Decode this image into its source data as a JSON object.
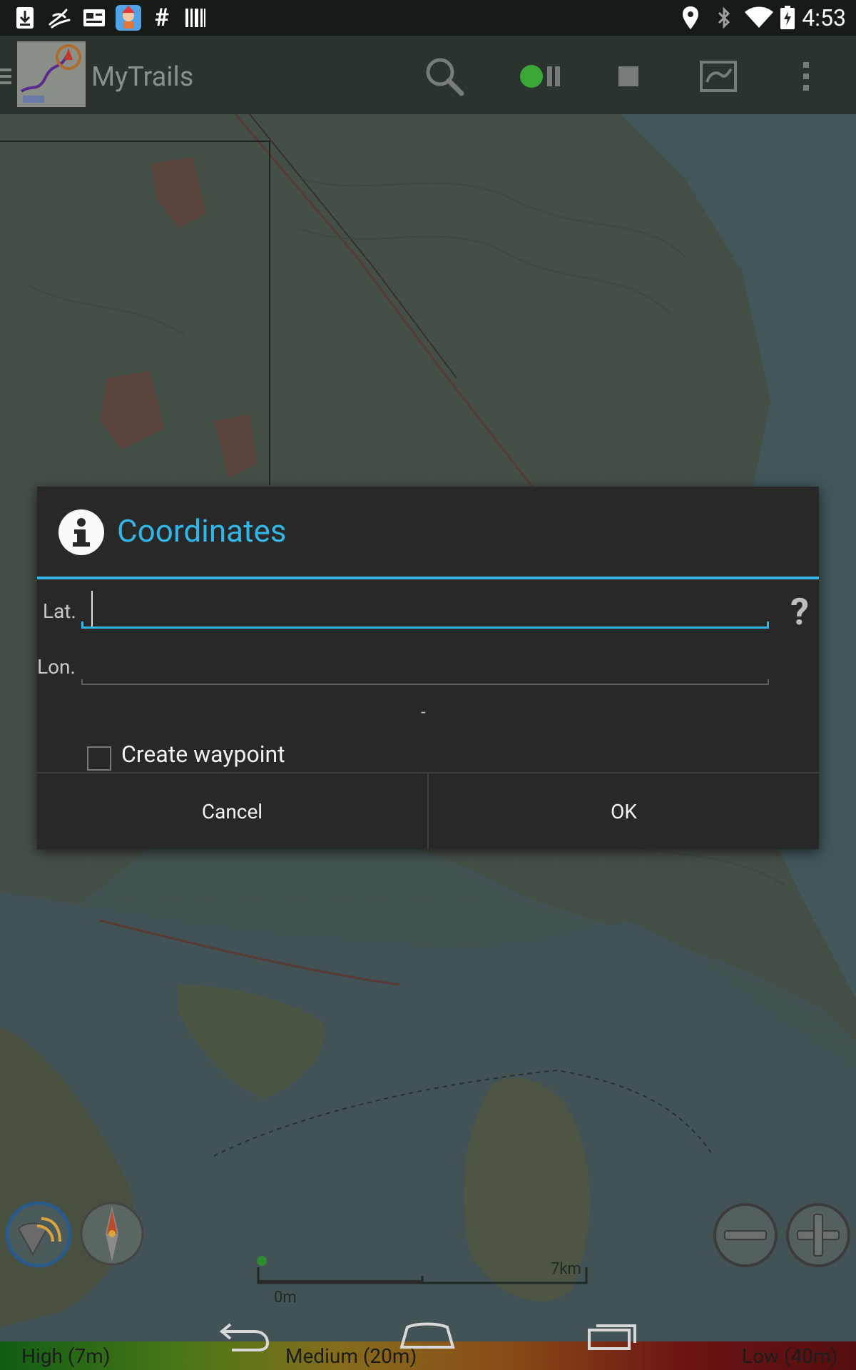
{
  "status_bar": {
    "time": "4:53",
    "left_icons": [
      "download-icon",
      "signature-icon",
      "news-card-icon",
      "app-badge-icon",
      "hash-icon",
      "barcode-icon"
    ],
    "right_icons": [
      "location-pin-icon",
      "bluetooth-icon",
      "wifi-icon",
      "battery-charging-icon"
    ]
  },
  "action_bar": {
    "app_title": "MyTrails",
    "buttons": [
      "search-icon",
      "record-pause-icon",
      "stop-icon",
      "map-layers-icon",
      "overflow-menu-icon"
    ]
  },
  "dialog": {
    "title": "Coordinates",
    "lat_label": "Lat.",
    "lat_value": "",
    "lon_label": "Lon.",
    "lon_value": "",
    "help": "?",
    "separator_text": "-",
    "checkbox_label": "Create waypoint",
    "checkbox_checked": false,
    "cancel_label": "Cancel",
    "ok_label": "OK"
  },
  "scale_bar": {
    "start_label": "0m",
    "end_label": "7km"
  },
  "accuracy_bar": {
    "high": "High (7m)",
    "medium": "Medium (20m)",
    "low": "Low (40m)"
  },
  "colors": {
    "accent": "#33b5e5",
    "dialog_bg": "#282828"
  }
}
